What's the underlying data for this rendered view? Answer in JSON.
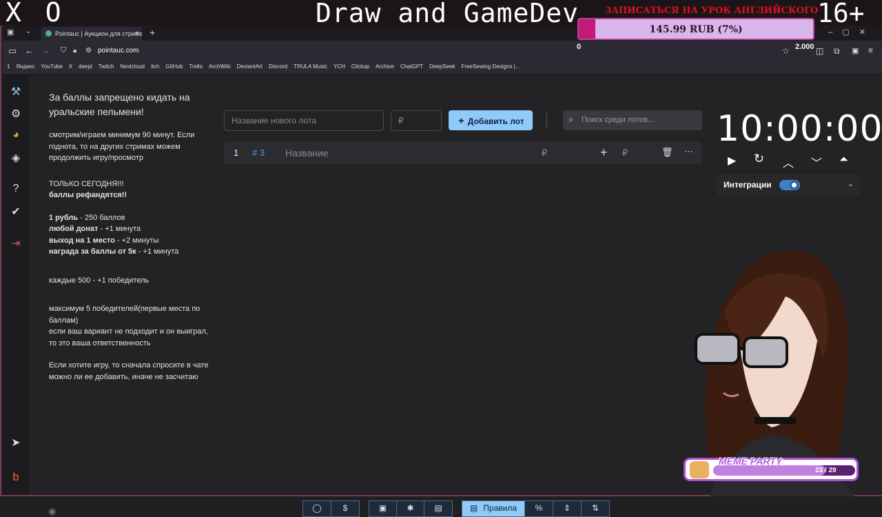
{
  "overlay": {
    "window_glyphs": "X_O",
    "stream_title": "Draw and GameDev",
    "promo": "ЗАПИСАТЬСЯ НА УРОК АНГЛИЙСКОГО",
    "donation_text": "145.99 RUB (7%)",
    "donation_progress": 0.07,
    "donation_min": "0",
    "donation_max": "2.000",
    "age_badge": "16+",
    "meme_title": "MEME PARTY",
    "meme_count": "23 / 29",
    "meme_progress": 0.79
  },
  "browser": {
    "tab_title": "Pointauc | Аукцион для стриме",
    "url": "pointauc.com",
    "bookmarks": [
      "1",
      "Яндекс",
      "YouTube",
      "X",
      "deepl",
      "Twitch",
      "Nextcloud",
      "itch",
      "GitHub",
      "Trello",
      "ArchWiki",
      "DeviantArt",
      "Discord",
      "TRULA Music",
      "YCH",
      "Clickup",
      "Archive",
      "ChatGPT",
      "DeepSeek",
      "FreeSewing Designs |..."
    ]
  },
  "rules": {
    "heading": "За баллы запрещено кидать на уральские пельмени!",
    "p1": "смотрим/играем минимум 90 минут. Если годнота, то на других стримах можем продолжить игру/просмотр",
    "p2a": "ТОЛЬКО СЕГОДНЯ!!!",
    "p2b": "баллы рефандятся!!",
    "r1b": "1 рубль",
    "r1": " - 250 баллов",
    "r2b": "любой донат",
    "r2": " - +1 минута",
    "r3b": "выход на 1 место",
    "r3": " - +2 минуты",
    "r4b": "награда за баллы от 5к",
    "r4": " - +1 минута",
    "p4": "каждые 500 - +1 победитель",
    "p5a": "максимум 5 победителей(первые места по баллам)",
    "p5b": "если ваш вариант не подходит и он выиграл, то это ваша ответственность",
    "p6": "Если хотите игру, то сначала спросите в чате можно ли ее добавить, иначе не засчитаю"
  },
  "form": {
    "name_placeholder": "Название нового лота",
    "amount_placeholder": "₽",
    "add_label": "Добавить лот",
    "search_placeholder": "Поиск среди лотов..."
  },
  "lot": {
    "index": "1",
    "id": "# 3",
    "name": "Название",
    "amount": "₽",
    "add_amount": "₽"
  },
  "timer": {
    "value": "10:00:00"
  },
  "integrations": {
    "label": "Интеграции",
    "enabled": true
  },
  "bottombar": {
    "rules_label": "Правила"
  },
  "colors": {
    "accent": "#90caf9",
    "toggle": "#3f7fc8",
    "donation_fill": "#c21a78"
  }
}
